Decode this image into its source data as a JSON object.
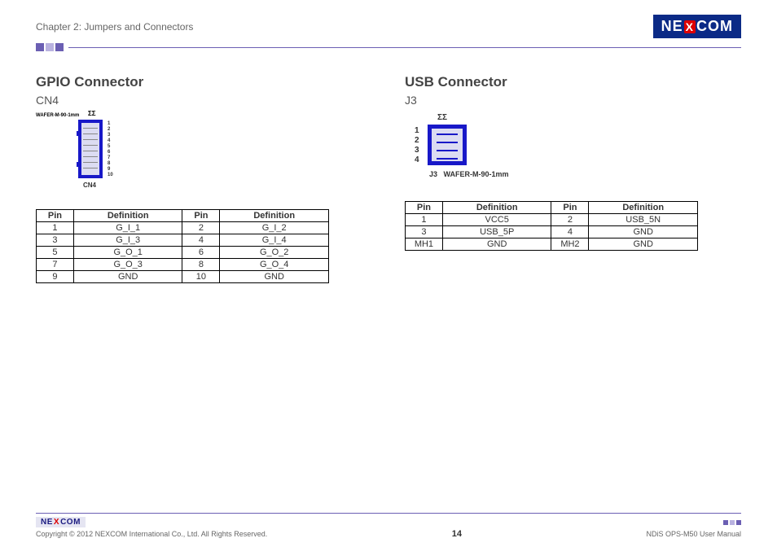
{
  "header": {
    "chapter": "Chapter 2: Jumpers and Connectors",
    "brand_before": "NE",
    "brand_x": "X",
    "brand_after": "COM"
  },
  "gpio": {
    "title": "GPIO Connector",
    "sub": "CN4",
    "diag_label": "WAFER-M-90-1mm",
    "diag_footer": "CN4",
    "sigma": "ΣΣ",
    "right_pins": "1\n2\n3\n4\n5\n6\n7\n8\n9\n10",
    "headers": {
      "pin": "Pin",
      "def": "Definition"
    },
    "rows": [
      {
        "p1": "1",
        "d1": "G_I_1",
        "p2": "2",
        "d2": "G_I_2"
      },
      {
        "p1": "3",
        "d1": "G_I_3",
        "p2": "4",
        "d2": "G_I_4"
      },
      {
        "p1": "5",
        "d1": "G_O_1",
        "p2": "6",
        "d2": "G_O_2"
      },
      {
        "p1": "7",
        "d1": "G_O_3",
        "p2": "8",
        "d2": "G_O_4"
      },
      {
        "p1": "9",
        "d1": "GND",
        "p2": "10",
        "d2": "GND"
      }
    ]
  },
  "usb": {
    "title": "USB Connector",
    "sub": "J3",
    "sigma": "ΣΣ",
    "leftnums": "1\n2\n3\n4",
    "bottom_label_j3": "J3",
    "bottom_label_wafer": "WAFER-M-90-1mm",
    "headers": {
      "pin": "Pin",
      "def": "Definition"
    },
    "rows": [
      {
        "p1": "1",
        "d1": "VCC5",
        "p2": "2",
        "d2": "USB_5N"
      },
      {
        "p1": "3",
        "d1": "USB_5P",
        "p2": "4",
        "d2": "GND"
      },
      {
        "p1": "MH1",
        "d1": "GND",
        "p2": "MH2",
        "d2": "GND"
      }
    ]
  },
  "footer": {
    "brand_before": "NE",
    "brand_x": "X",
    "brand_after": "COM",
    "copyright": "Copyright © 2012 NEXCOM International Co., Ltd. All Rights Reserved.",
    "page_num": "14",
    "manual": "NDiS OPS-M50 User Manual"
  }
}
